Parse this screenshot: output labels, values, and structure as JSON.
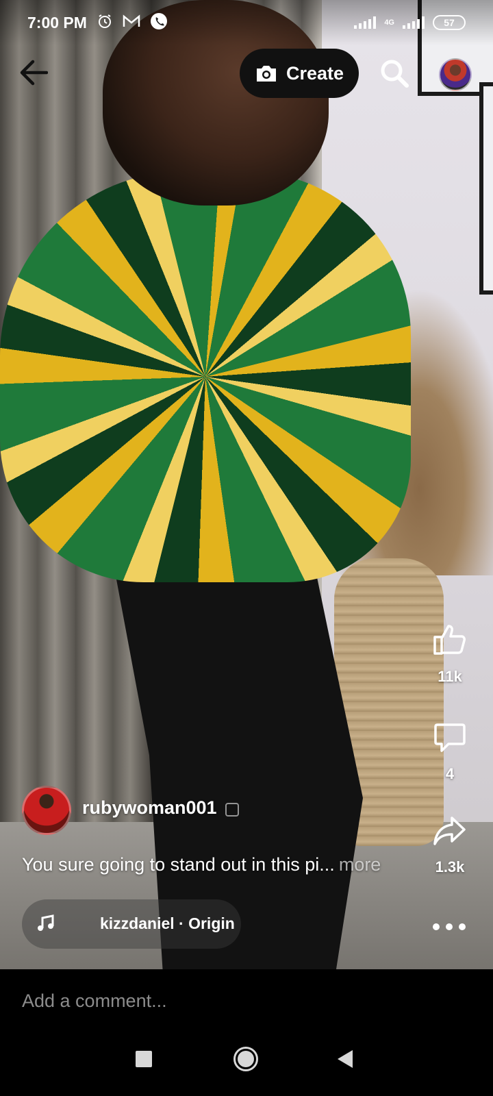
{
  "status_bar": {
    "time": "7:00 PM",
    "battery": "57",
    "network": "4G",
    "icons": [
      "alarm-icon",
      "gmail-icon",
      "phone-icon",
      "signal-icon",
      "battery-icon"
    ]
  },
  "top_bar": {
    "create_label": "Create",
    "icons": [
      "back-arrow-icon",
      "camera-icon",
      "search-icon"
    ]
  },
  "reel": {
    "author": "rubywoman001",
    "caption": "You sure going to stand out in this pi...",
    "caption_more": "more",
    "audio": "kizzdaniel · Origin"
  },
  "actions": {
    "likes": "11k",
    "comments": "4",
    "shares": "1.3k",
    "icons": [
      "thumbs-up-icon",
      "comment-icon",
      "share-icon",
      "more-icon"
    ]
  },
  "comment": {
    "placeholder": "Add a comment..."
  },
  "colors": {
    "background": "#000000",
    "text": "#ffffff",
    "muted_text": "#8c8c8c",
    "create_pill": "#111111"
  }
}
